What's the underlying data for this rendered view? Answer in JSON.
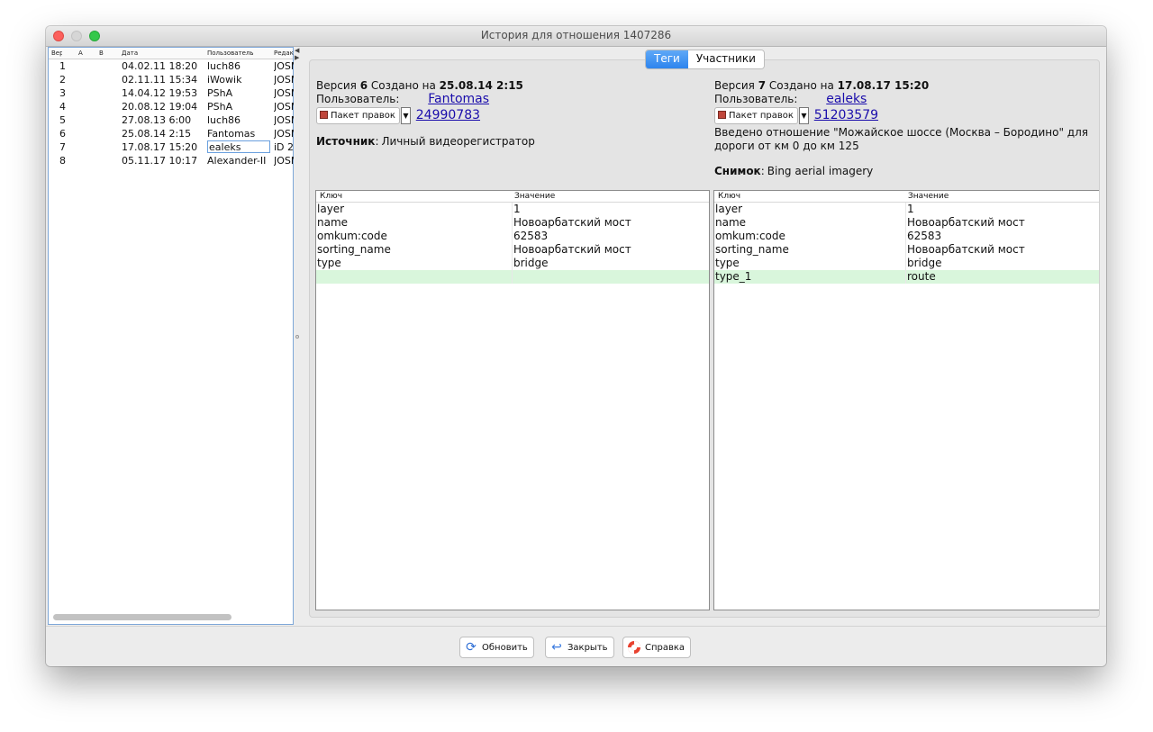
{
  "window": {
    "title": "История для отношения 1407286"
  },
  "history": {
    "columns": [
      "Вер.",
      "A",
      "B",
      "Дата",
      "Пользователь",
      "Редак"
    ],
    "rows": [
      {
        "ver": "1",
        "a": false,
        "b": false,
        "date": "04.02.11 18:20",
        "user": "luch86",
        "editor": "JOSM"
      },
      {
        "ver": "2",
        "a": false,
        "b": false,
        "date": "02.11.11 15:34",
        "user": "iWowik",
        "editor": "JOSM"
      },
      {
        "ver": "3",
        "a": false,
        "b": false,
        "date": "14.04.12 19:53",
        "user": "PShA",
        "editor": "JOSM"
      },
      {
        "ver": "4",
        "a": false,
        "b": false,
        "date": "20.08.12 19:04",
        "user": "PShA",
        "editor": "JOSM"
      },
      {
        "ver": "5",
        "a": false,
        "b": false,
        "date": "27.08.13 6:00",
        "user": "luch86",
        "editor": "JOSM"
      },
      {
        "ver": "6",
        "a": true,
        "b": false,
        "date": "25.08.14 2:15",
        "user": "Fantomas",
        "editor": "JOSM"
      },
      {
        "ver": "7",
        "a": false,
        "b": true,
        "date": "17.08.17 15:20",
        "user": "ealeks",
        "editor": "iD 2"
      },
      {
        "ver": "8",
        "a": false,
        "b": false,
        "date": "05.11.17 10:17",
        "user": "Alexander-II",
        "editor": "JOSM"
      }
    ]
  },
  "tabs": {
    "tags": "Теги",
    "members": "Участники"
  },
  "left": {
    "version_word": "Версия",
    "version": "6",
    "created_word": "Создано на",
    "date": "25.08.14 2:15",
    "user_label": "Пользователь:",
    "user": "Fantomas",
    "changeset_label": "Пакет правок",
    "changeset": "24990783",
    "source_label": "Источник",
    "source": "Личный видеорегистратор"
  },
  "right": {
    "version_word": "Версия",
    "version": "7",
    "created_word": "Создано на",
    "date": "17.08.17 15:20",
    "user_label": "Пользователь:",
    "user": "ealeks",
    "changeset_label": "Пакет правок",
    "changeset": "51203579",
    "comment_line1": "Введено отношение \"Можайское шоссе (Москва – Бородино\" для",
    "comment_line2": "дороги от км 0 до км 125",
    "imagery_label": "Снимок",
    "imagery": "Bing aerial imagery"
  },
  "tag_table": {
    "key_header": "Ключ",
    "value_header": "Значение",
    "left_rows": [
      {
        "key": "layer",
        "value": "1"
      },
      {
        "key": "name",
        "value": "Новоарбатский мост"
      },
      {
        "key": "omkum:code",
        "value": "62583"
      },
      {
        "key": "sorting_name",
        "value": "Новоарбатский мост"
      },
      {
        "key": "type",
        "value": "bridge"
      },
      {
        "key": "",
        "value": ""
      }
    ],
    "right_rows": [
      {
        "key": "layer",
        "value": "1"
      },
      {
        "key": "name",
        "value": "Новоарбатский мост"
      },
      {
        "key": "omkum:code",
        "value": "62583"
      },
      {
        "key": "sorting_name",
        "value": "Новоарбатский мост"
      },
      {
        "key": "type",
        "value": "bridge"
      },
      {
        "key": "type_1",
        "value": "route"
      }
    ]
  },
  "buttons": {
    "refresh": "Обновить",
    "close": "Закрыть",
    "help": "Справка"
  },
  "colors": {
    "added_row": "#d9f6dc",
    "tab_active": "#2d84ee",
    "link": "#1a0dab"
  }
}
